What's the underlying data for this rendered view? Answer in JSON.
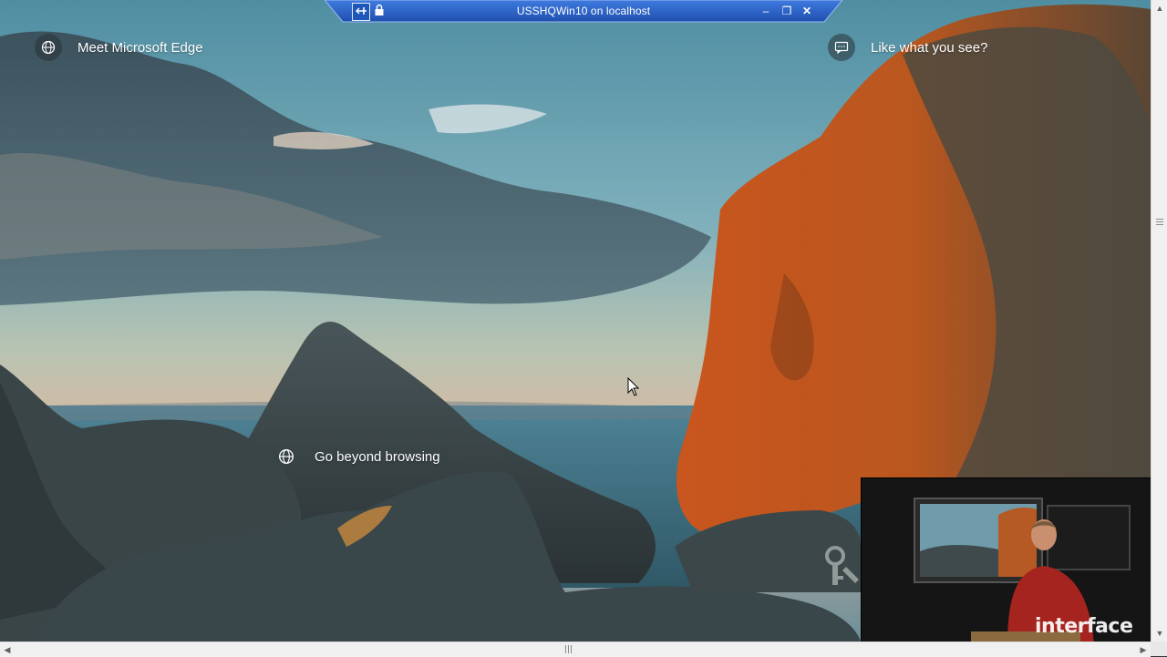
{
  "rdp_bar": {
    "title": "USSHQWin10 on localhost",
    "pin_icon": "pin-icon",
    "lock_icon": "lock-icon",
    "minimize_label": "–",
    "restore_label": "❐",
    "close_label": "✕",
    "bar_color": "#2a63c8"
  },
  "lock_screen": {
    "edge_prompt": "Meet Microsoft Edge",
    "like_prompt": "Like what you see?",
    "browse_prompt": "Go beyond browsing",
    "edge_icon": "globe-icon",
    "like_icon": "chat-icon",
    "browse_icon": "globe-icon"
  },
  "pip": {
    "logo": "interface",
    "logo_icon": "interface-x-icon"
  },
  "scrollbars": {
    "up": "▲",
    "down": "▼",
    "left": "◀",
    "right": "▶"
  }
}
